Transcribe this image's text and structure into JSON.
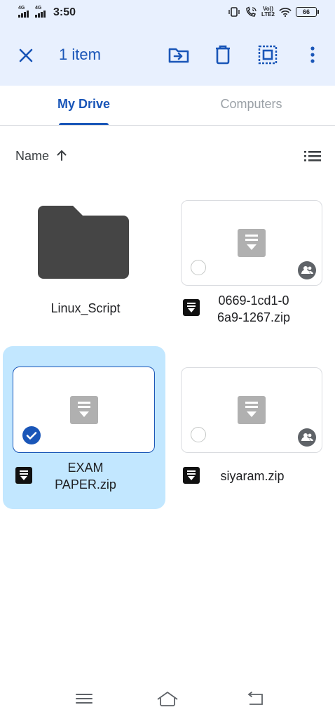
{
  "status_bar": {
    "sim1": "4G",
    "sim2": "4G",
    "time": "3:50",
    "volte_top": "Vo))",
    "volte_bottom": "LTE2",
    "battery": "66"
  },
  "selection_bar": {
    "count_label": "1 item",
    "icons": [
      "close-icon",
      "move-to-folder-icon",
      "delete-icon",
      "select-all-icon",
      "more-vert-icon"
    ]
  },
  "tabs": [
    {
      "label": "My Drive",
      "active": true
    },
    {
      "label": "Computers",
      "active": false
    }
  ],
  "sort": {
    "label": "Name",
    "direction": "ascending",
    "view": "grid"
  },
  "items": [
    {
      "name": "Linux_Script",
      "type": "folder",
      "shared": false,
      "selected": false
    },
    {
      "name_line1": "0669-1cd1-0",
      "name_line2": "6a9-1267.zip",
      "type": "zip",
      "shared": true,
      "selected": false
    },
    {
      "name_line1": "EXAM",
      "name_line2": "PAPER.zip",
      "type": "zip",
      "shared": false,
      "selected": true
    },
    {
      "name": "siyaram.zip",
      "type": "zip",
      "shared": true,
      "selected": false
    }
  ],
  "colors": {
    "accent": "#1a56b8",
    "selection_fill": "#c2e7ff",
    "appbar_bg": "#e8f0fe",
    "folder": "#454545"
  },
  "nav_bar": {
    "icons": [
      "menu-icon",
      "home-icon",
      "back-icon"
    ]
  }
}
